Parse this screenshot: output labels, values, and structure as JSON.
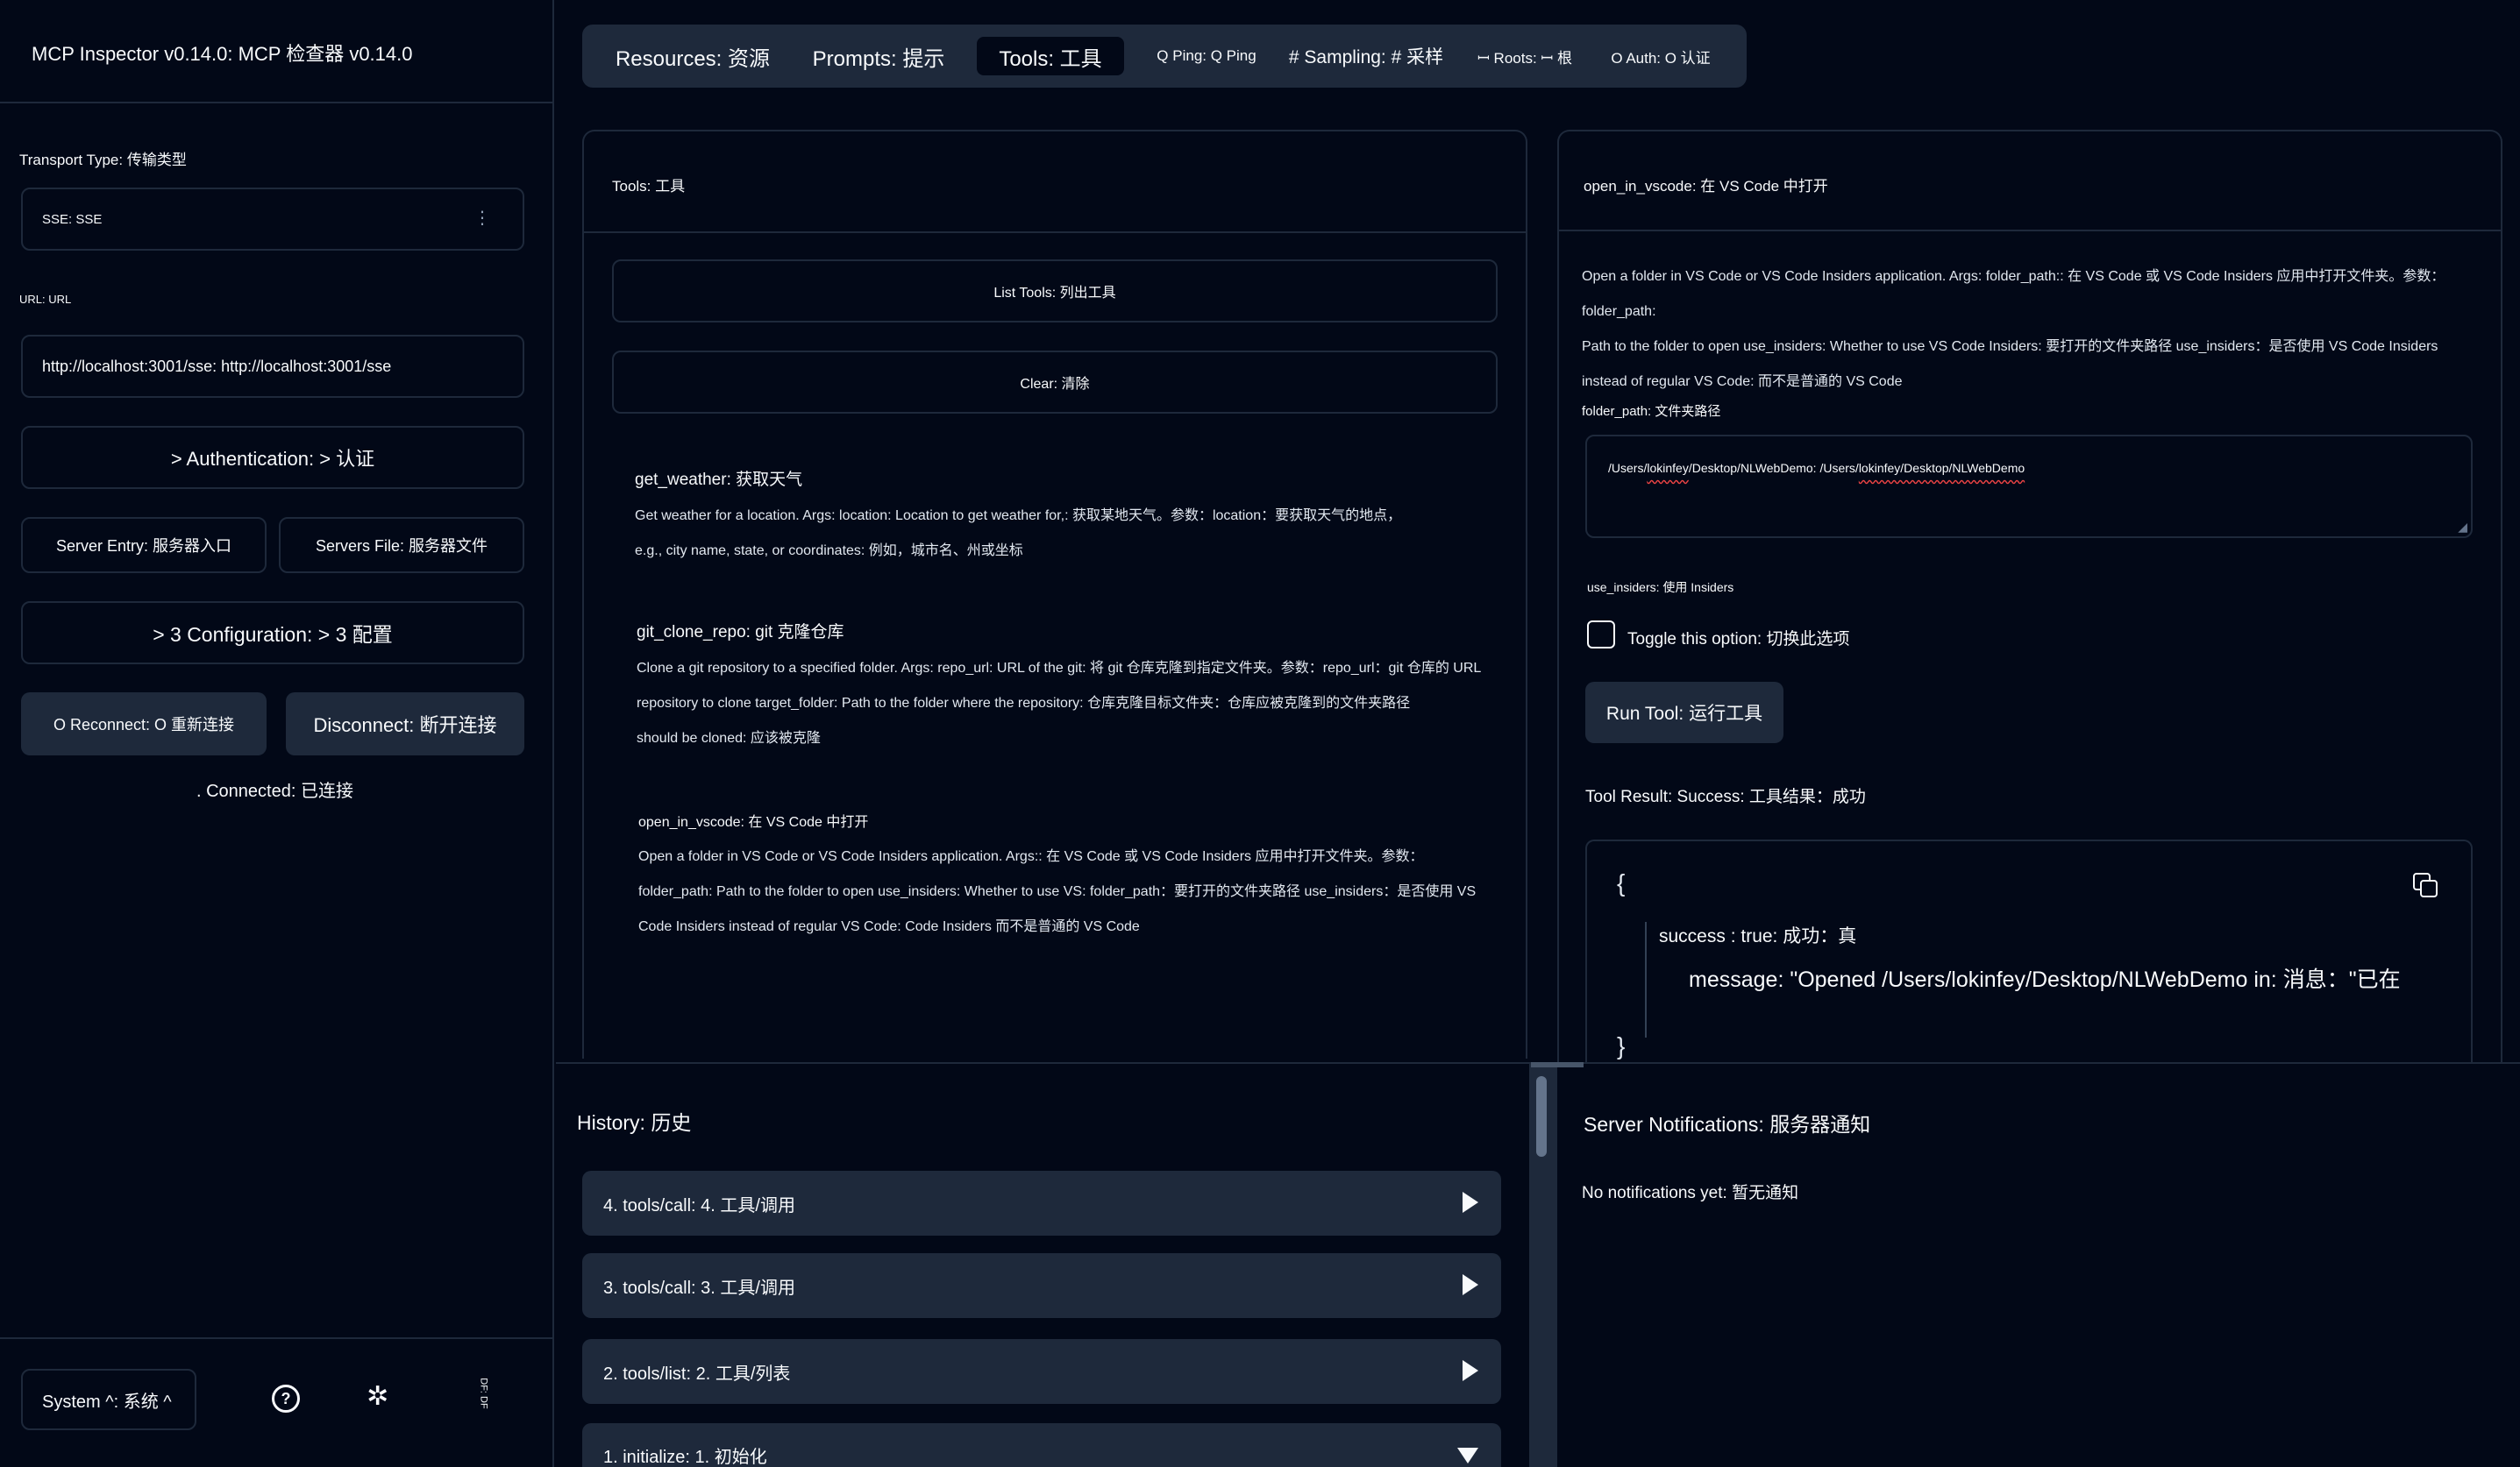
{
  "app": {
    "title": "MCP Inspector v0.14.0: MCP 检查器 v0.14.0"
  },
  "sidebar": {
    "transport_label": "Transport Type: 传输类型",
    "transport_value": "SSE: SSE",
    "url_label": "URL: URL",
    "url_value": "http://localhost:3001/sse: http://localhost:3001/sse",
    "authentication": "> Authentication: > 认证",
    "server_entry": "Server Entry: 服务器入口",
    "servers_file": "Servers File: 服务器文件",
    "configuration": "> 3 Configuration: > 3 配置",
    "reconnect": "O Reconnect: O 重新连接",
    "disconnect": "Disconnect: 断开连接",
    "status": ". Connected: 已连接",
    "theme_select": "System ^: 系统 ^",
    "extra_label": "DF: DF"
  },
  "tabs": [
    {
      "label": "Resources: 资源"
    },
    {
      "label": "Prompts: 提示"
    },
    {
      "label": "Tools: 工具"
    },
    {
      "label": "Q Ping: Q Ping"
    },
    {
      "label": "# Sampling: # 采样"
    },
    {
      "label": "ꟷ Roots: ꟷ 根"
    },
    {
      "label": "O Auth: O 认证"
    }
  ],
  "tools_panel": {
    "header": "Tools: 工具",
    "list_button": "List Tools: 列出工具",
    "clear_button": "Clear: 清除",
    "tools": [
      {
        "name": "get_weather: 获取天气",
        "desc_lines": [
          "Get weather for a location. Args: location: Location to get weather for,: 获取某地天气。参数：location：要获取天气的地点，",
          "e.g., city name, state, or coordinates: 例如，城市名、州或坐标"
        ]
      },
      {
        "name": "git_clone_repo: git 克隆仓库",
        "desc_lines": [
          "Clone a git repository to a specified folder. Args: repo_url: URL of the git: 将 git 仓库克隆到指定文件夹。参数：repo_url：git 仓库的 URL",
          "repository to clone target_folder: Path to the folder where the repository: 仓库克隆目标文件夹：仓库应被克隆到的文件夹路径",
          "should be cloned: 应该被克隆"
        ]
      },
      {
        "name": "open_in_vscode: 在 VS Code 中打开",
        "desc_lines": [
          "Open a folder in VS Code or VS Code Insiders application. Args:: 在 VS Code 或 VS Code Insiders 应用中打开文件夹。参数：",
          "folder_path: Path to the folder to open use_insiders: Whether to use VS: folder_path：要打开的文件夹路径 use_insiders：是否使用 VS",
          "Code Insiders instead of regular VS Code: Code Insiders 而不是普通的 VS Code"
        ]
      }
    ]
  },
  "detail_panel": {
    "header": "open_in_vscode: 在 VS Code 中打开",
    "desc_lines": [
      "Open a folder in VS Code or VS Code Insiders application. Args: folder_path:: 在 VS Code 或 VS Code Insiders 应用中打开文件夹。参数：folder_path:",
      "Path to the folder to open use_insiders: Whether to use VS Code Insiders: 要打开的文件夹路径 use_insiders：是否使用 VS Code Insiders",
      "instead of regular VS Code: 而不是普通的 VS Code"
    ],
    "folder_label": "folder_path: 文件夹路径",
    "folder_value_pre": "/Users/",
    "folder_value_user1": "lokinfey",
    "folder_value_mid": "/Desktop/NLWebDemo: /Users/",
    "folder_value_user2": "lokinfey/Desktop/NLWebDemo",
    "insiders_label": "use_insiders: 使用 Insiders",
    "toggle_label": "Toggle this option: 切换此选项",
    "run_button": "Run Tool: 运行工具",
    "result_label": "Tool Result: Success: 工具结果：成功",
    "json_open": "{",
    "json_success": "success : true: 成功：真",
    "json_message": "message: \"Opened /Users/lokinfey/Desktop/NLWebDemo in: 消息：\"已在",
    "json_close": "}"
  },
  "history": {
    "title": "History: 历史",
    "items": [
      {
        "label": "4. tools/call: 4. 工具/调用"
      },
      {
        "label": "3. tools/call: 3. 工具/调用"
      },
      {
        "label": "2. tools/list: 2. 工具/列表"
      },
      {
        "label": "1. initialize: 1. 初始化"
      }
    ]
  },
  "notifications": {
    "title": "Server Notifications: 服务器通知",
    "empty": "No notifications yet: 暂无通知"
  },
  "colors": {
    "background": "#020817",
    "surface": "#1e293b",
    "text": "#f8fafc"
  }
}
